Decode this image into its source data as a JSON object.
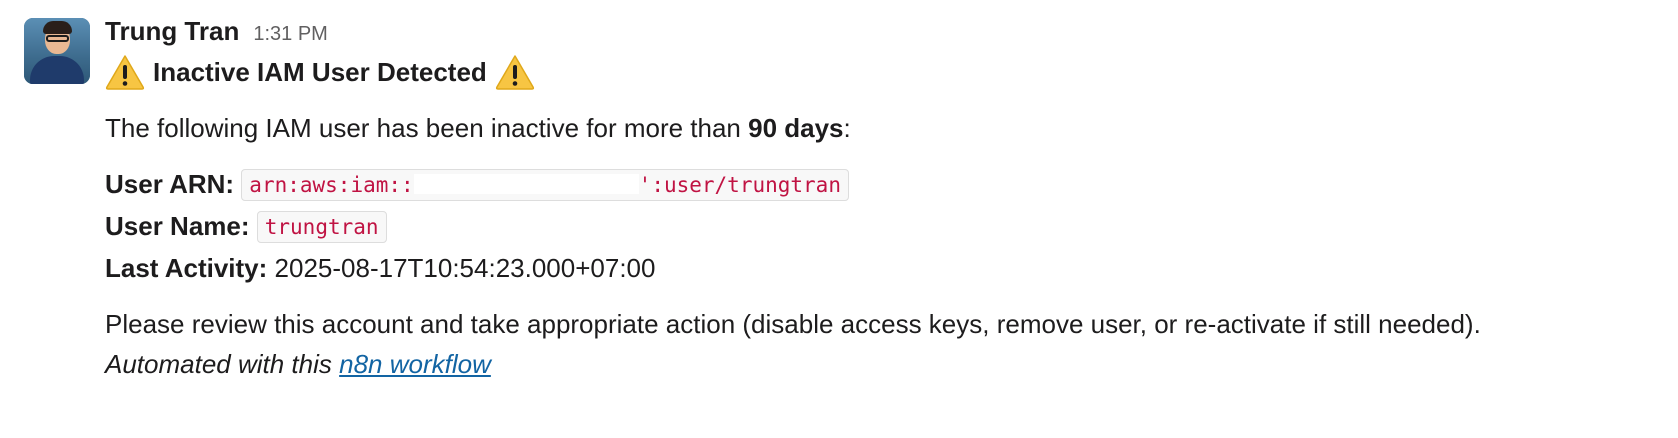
{
  "message": {
    "sender": "Trung Tran",
    "timestamp": "1:31 PM",
    "title_icon": "warning-icon",
    "title": "Inactive IAM User Detected",
    "intro_prefix": "The following IAM user has been inactive for more than ",
    "intro_bold": "90 days",
    "intro_suffix": ":",
    "fields": {
      "arn_label": "User ARN:",
      "arn_prefix": "arn:aws:iam::",
      "arn_suffix": "':user/trungtran",
      "username_label": "User Name:",
      "username_value": "trungtran",
      "activity_label": "Last Activity:",
      "activity_value": "2025-08-17T10:54:23.000+07:00"
    },
    "review_text": "Please review this account and take appropriate action (disable access keys, remove user, or re-activate if still needed).",
    "footer_prefix": "Automated with this ",
    "footer_link": "n8n workflow"
  },
  "colors": {
    "code_text": "#c01343",
    "link": "#1264a3",
    "warning_fill": "#f7c543"
  }
}
